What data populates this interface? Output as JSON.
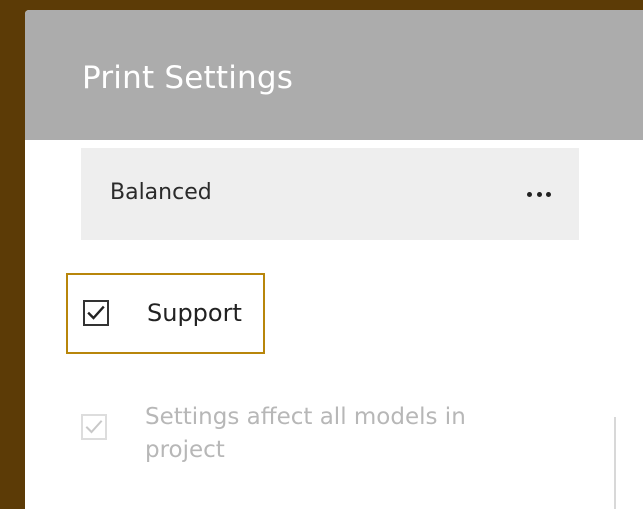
{
  "panel": {
    "title": "Print Settings"
  },
  "profile": {
    "selected_label": "Balanced",
    "more_icon": "ellipsis-icon"
  },
  "options": {
    "support": {
      "label": "Support",
      "checked": true
    },
    "apply_all": {
      "label": "Settings affect all models in project",
      "checked": true,
      "enabled": false
    }
  },
  "colors": {
    "background": "#5c3b06",
    "header": "#acacac",
    "focus_outline": "#b8860b",
    "disabled_text": "#b7b7b7"
  }
}
